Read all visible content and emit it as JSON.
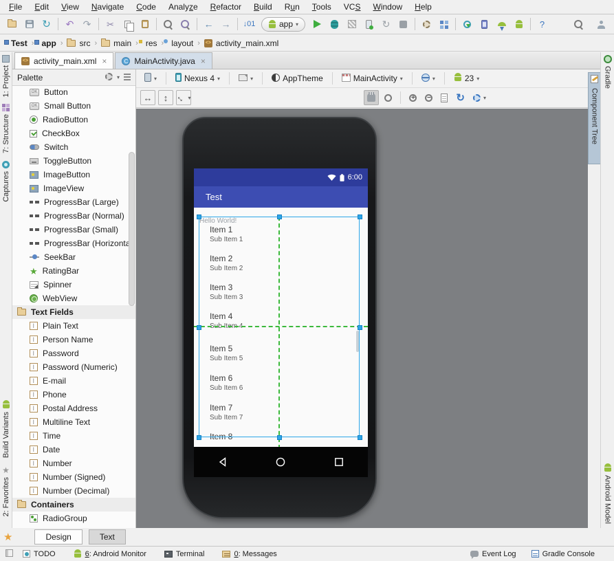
{
  "menubar": {
    "items": [
      {
        "label": "File",
        "m": 0
      },
      {
        "label": "Edit",
        "m": 0
      },
      {
        "label": "View",
        "m": 0
      },
      {
        "label": "Navigate",
        "m": 0
      },
      {
        "label": "Code",
        "m": 0
      },
      {
        "label": "Analyze",
        "m": 5
      },
      {
        "label": "Refactor",
        "m": 0
      },
      {
        "label": "Build",
        "m": 0
      },
      {
        "label": "Run",
        "m": 1
      },
      {
        "label": "Tools",
        "m": 0
      },
      {
        "label": "VCS",
        "m": 2
      },
      {
        "label": "Window",
        "m": 0
      },
      {
        "label": "Help",
        "m": 0
      }
    ]
  },
  "toolbar": {
    "items": [
      "open-file",
      "save-all",
      "sync",
      "sep",
      "undo",
      "redo",
      "sep",
      "cut",
      "copy",
      "paste",
      "sep",
      "find",
      "find-usages",
      "sep",
      "back",
      "forward",
      "sep",
      "make-project",
      "app-combo",
      "run",
      "debug",
      "coverage",
      "attach-debugger",
      "rerun",
      "stop",
      "sep",
      "avd-manager",
      "project-structure",
      "sep",
      "gradle-sync",
      "device-monitor",
      "sdk-manager",
      "android-monitor",
      "sep",
      "help"
    ],
    "app_selector_label": "app",
    "right_items": [
      "search",
      "avatar"
    ]
  },
  "breadcrumbs": {
    "items": [
      {
        "label": "Test",
        "icon": "module-folder",
        "bold": true
      },
      {
        "label": "app",
        "icon": "module-folder",
        "bold": true
      },
      {
        "label": "src",
        "icon": "folder",
        "bold": false
      },
      {
        "label": "main",
        "icon": "folder",
        "bold": false
      },
      {
        "label": "res",
        "icon": "res-folder",
        "bold": false
      },
      {
        "label": "layout",
        "icon": "layout-folder",
        "bold": false
      },
      {
        "label": "activity_main.xml",
        "icon": "xml-file",
        "bold": false
      }
    ]
  },
  "editor_tabs": [
    {
      "label": "activity_main.xml",
      "icon": "xml-file",
      "close": "×",
      "active": true
    },
    {
      "label": "MainActivity.java",
      "icon": "java-class",
      "close": "×",
      "active": false
    }
  ],
  "left_toolbar": {
    "top": [
      {
        "label": "1: Project",
        "icon": "project-tw"
      },
      {
        "label": "7: Structure",
        "icon": "structure-tw"
      },
      {
        "label": "Captures",
        "icon": "captures-tw"
      }
    ],
    "bottom": [
      {
        "label": "Build Variants",
        "icon": "android-small"
      },
      {
        "label": "2: Favorites",
        "icon": "star"
      }
    ]
  },
  "right_toolbar": {
    "top": [
      {
        "label": "Gradle",
        "icon": "gradle"
      }
    ],
    "selected_tab": {
      "label": "Component Tree",
      "icon": "component-tree"
    },
    "bottom": [
      {
        "label": "Android Model",
        "icon": "android-small"
      }
    ]
  },
  "palette": {
    "title": "Palette",
    "header_icons": [
      "gear-small",
      "pin"
    ],
    "items": [
      {
        "label": "Button",
        "icon": "button",
        "text": "OK"
      },
      {
        "label": "Small Button",
        "icon": "button",
        "text": "OK"
      },
      {
        "label": "RadioButton",
        "icon": "radio"
      },
      {
        "label": "CheckBox",
        "icon": "checkbox"
      },
      {
        "label": "Switch",
        "icon": "switch"
      },
      {
        "label": "ToggleButton",
        "icon": "toggle"
      },
      {
        "label": "ImageButton",
        "icon": "image"
      },
      {
        "label": "ImageView",
        "icon": "image"
      },
      {
        "label": "ProgressBar (Large)",
        "icon": "progress"
      },
      {
        "label": "ProgressBar (Normal)",
        "icon": "progress"
      },
      {
        "label": "ProgressBar (Small)",
        "icon": "progress"
      },
      {
        "label": "ProgressBar (Horizontal)",
        "icon": "progress"
      },
      {
        "label": "SeekBar",
        "icon": "seekbar"
      },
      {
        "label": "RatingBar",
        "icon": "rating",
        "text": "★"
      },
      {
        "label": "Spinner",
        "icon": "spinner"
      },
      {
        "label": "WebView",
        "icon": "webview"
      },
      {
        "label": "Text Fields",
        "icon": "folder",
        "header": true
      },
      {
        "label": "Plain Text",
        "icon": "textfield"
      },
      {
        "label": "Person Name",
        "icon": "textfield"
      },
      {
        "label": "Password",
        "icon": "textfield"
      },
      {
        "label": "Password (Numeric)",
        "icon": "textfield"
      },
      {
        "label": "E-mail",
        "icon": "textfield"
      },
      {
        "label": "Phone",
        "icon": "textfield"
      },
      {
        "label": "Postal Address",
        "icon": "textfield"
      },
      {
        "label": "Multiline Text",
        "icon": "textfield"
      },
      {
        "label": "Time",
        "icon": "textfield"
      },
      {
        "label": "Date",
        "icon": "textfield"
      },
      {
        "label": "Number",
        "icon": "textfield"
      },
      {
        "label": "Number (Signed)",
        "icon": "textfield"
      },
      {
        "label": "Number (Decimal)",
        "icon": "textfield"
      },
      {
        "label": "Containers",
        "icon": "folder",
        "header": true
      },
      {
        "label": "RadioGroup",
        "icon": "radiogroup"
      }
    ]
  },
  "design_toolbar": {
    "device": "Nexus 4",
    "theme": "AppTheme",
    "activity": "MainActivity",
    "api_level": "23",
    "zoom_left_icons": [
      "expand-h",
      "expand-v",
      "expand-all"
    ],
    "zoom_right_icons": [
      "pan",
      "zoom-fit",
      "sep",
      "zoom-in",
      "zoom-out",
      "preview-doc",
      "refresh",
      "settings-gear"
    ]
  },
  "device_preview": {
    "status_time": "6:00",
    "app_title": "Test",
    "hello_text": "Hello World!",
    "list_items": [
      {
        "title": "Item 1",
        "subtitle": "Sub Item 1"
      },
      {
        "title": "Item 2",
        "subtitle": "Sub Item 2"
      },
      {
        "title": "Item 3",
        "subtitle": "Sub Item 3"
      },
      {
        "title": "Item 4",
        "subtitle": "Sub Item 4"
      },
      {
        "title": "Item 5",
        "subtitle": "Sub Item 5"
      },
      {
        "title": "Item 6",
        "subtitle": "Sub Item 6"
      },
      {
        "title": "Item 7",
        "subtitle": "Sub Item 7"
      },
      {
        "title": "Item 8",
        "subtitle": ""
      }
    ]
  },
  "bottom_tabs": [
    {
      "label": "Design",
      "active": true
    },
    {
      "label": "Text",
      "active": false
    }
  ],
  "statusbar": {
    "left": [
      {
        "label": "TODO",
        "icon": "todo",
        "u": false
      },
      {
        "label": "6: Android Monitor",
        "icon": "android-small",
        "u": true
      },
      {
        "label": "Terminal",
        "icon": "terminal",
        "u": false
      },
      {
        "label": "0: Messages",
        "icon": "messages",
        "u": true
      }
    ],
    "right": [
      {
        "label": "Event Log",
        "icon": "event-log"
      },
      {
        "label": "Gradle Console",
        "icon": "gradle-console"
      }
    ]
  },
  "colors": {
    "app_bar_blue": "#3d4db2",
    "status_bar_blue": "#2e3c9c",
    "selection_blue": "#2da6e8",
    "guide_green": "#3cb93c",
    "run_green": "#3fae3f",
    "android_green": "#97bf3d"
  }
}
